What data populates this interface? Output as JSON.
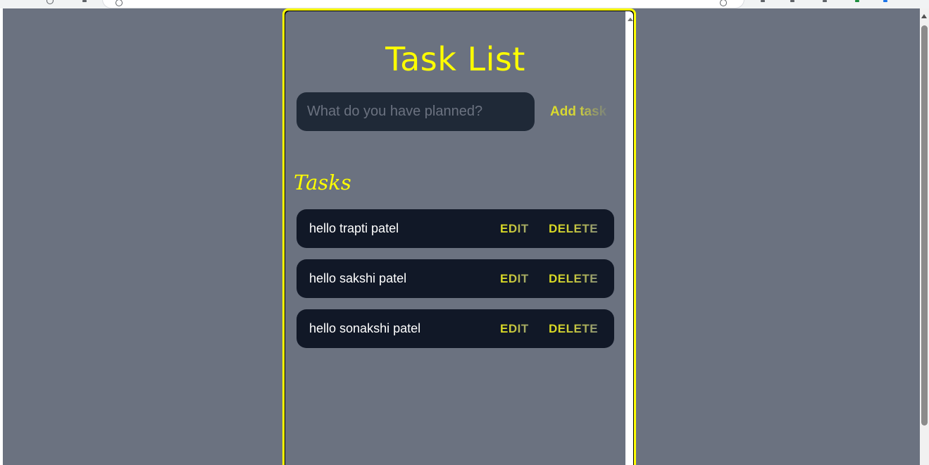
{
  "app": {
    "title": "Task List",
    "new_task": {
      "placeholder": "What do you have planned?",
      "value": "",
      "submit_label": "Add task"
    },
    "tasks_heading": "Tasks",
    "tasks": [
      {
        "text": "hello trapti patel",
        "edit_label": "EDIT",
        "delete_label": "DELETE"
      },
      {
        "text": "hello sakshi patel",
        "edit_label": "EDIT",
        "delete_label": "DELETE"
      },
      {
        "text": "hello sonakshi patel",
        "edit_label": "EDIT",
        "delete_label": "DELETE"
      }
    ]
  },
  "colors": {
    "page_background": "#6b7280",
    "accent_yellow": "#ffff00",
    "input_background": "#1f2937",
    "task_background": "#111827",
    "task_text": "#ffffff"
  },
  "icons": [
    "scroll-up-arrow-icon"
  ]
}
